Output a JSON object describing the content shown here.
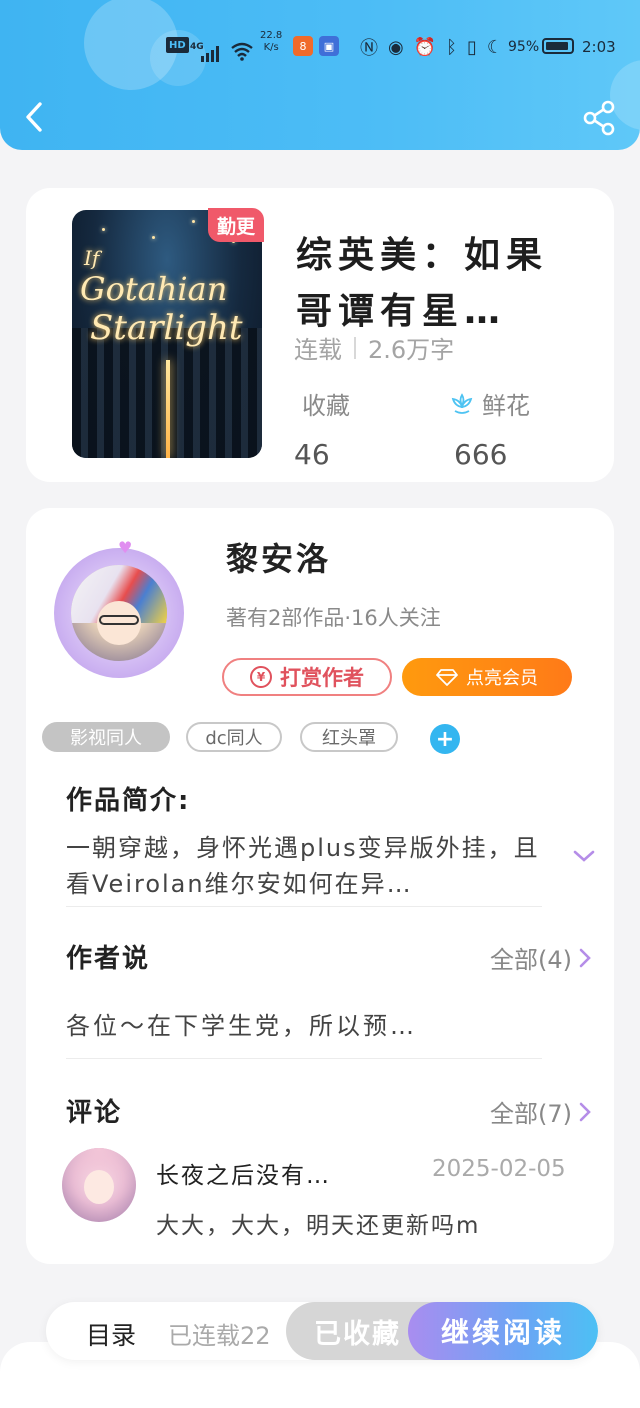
{
  "status_bar": {
    "hd": "HD",
    "network": "4G",
    "speed_value": "22.8",
    "speed_unit": "K/s",
    "battery_pct": "95%",
    "time": "2:03"
  },
  "book": {
    "badge": "勤更",
    "cover_text": [
      "If",
      "Gotahian",
      "Starlight"
    ],
    "title": "综英美：如果哥谭有星…",
    "status": "连载",
    "word_count": "2.6万字",
    "collect_label": "收藏",
    "flower_label": "鲜花",
    "collect_count": "46",
    "flower_count": "666"
  },
  "author": {
    "name": "黎安洛",
    "meta": "著有2部作品·16人关注",
    "reward_label": "打赏作者",
    "vip_label": "点亮会员",
    "yen": "¥"
  },
  "tags": [
    "影视同人",
    "dc同人",
    "红头罩"
  ],
  "intro": {
    "title": "作品简介:",
    "text": "一朝穿越，身怀光遇plus变异版外挂，且看Veirolan维尔安如何在异…"
  },
  "author_says": {
    "title": "作者说",
    "all_label": "全部(4)",
    "text": "各位～在下学生党，所以预…"
  },
  "comments": {
    "title": "评论",
    "all_label": "全部(7)",
    "items": [
      {
        "user": "长夜之后没有…",
        "date": "2025-02-05",
        "text": "大大，大大，明天还更新吗m"
      }
    ]
  },
  "bottom": {
    "toc_label": "目录",
    "serial_label": "已连载22",
    "fav_label": "已收藏",
    "continue_label": "继续阅读"
  },
  "colors": {
    "header_blue": "#4dbdf6",
    "badge_red": "#f0596a",
    "reward_red": "#e0525d",
    "vip_orange": "#ff8a14",
    "accent_purple": "#a98df0"
  }
}
